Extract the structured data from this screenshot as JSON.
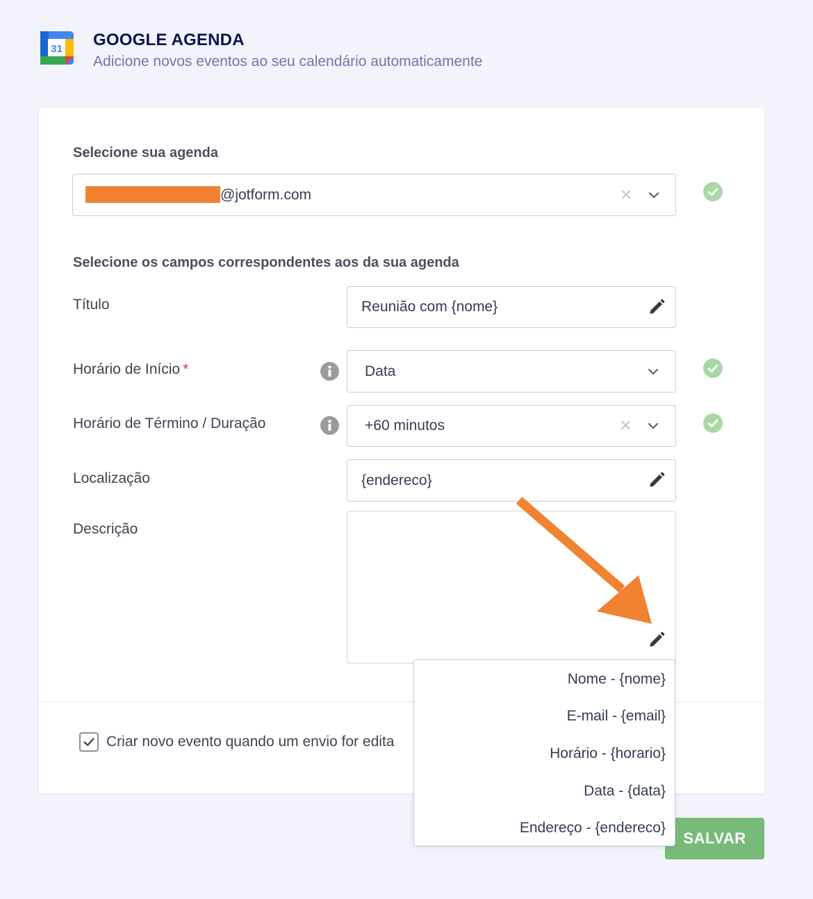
{
  "header": {
    "logo_text": "31",
    "title": "GOOGLE AGENDA",
    "subtitle": "Adicione novos eventos ao seu calendário automaticamente"
  },
  "calendar": {
    "label": "Selecione sua agenda",
    "selected_value": "@jotform.com"
  },
  "fields_section": {
    "label": "Selecione os campos correspondentes aos da sua agenda",
    "rows": [
      {
        "label": "Título",
        "value": "Reunião com {nome}"
      },
      {
        "label": "Horário de Início",
        "required_mark": "*",
        "value": "Data"
      },
      {
        "label": "Horário de Término / Duração",
        "value": "+60 minutos"
      },
      {
        "label": "Localização",
        "value": "{endereco}"
      },
      {
        "label": "Descrição",
        "value": ""
      }
    ]
  },
  "dropdown": {
    "items": [
      "Nome - {nome}",
      "E-mail - {email}",
      "Horário - {horario}",
      "Data - {data}",
      "Endereço - {endereco}"
    ]
  },
  "options": {
    "create_on_edit_label": "Criar novo evento quando um envio for edita",
    "create_on_edit_checked": true
  },
  "save_button": "SALVAR",
  "clear_symbol": "✕",
  "colors": {
    "accent_green": "#78bb79",
    "check_green": "#a9d8a5",
    "annotation_arrow": "#f08232",
    "title_navy": "#0a1551"
  }
}
